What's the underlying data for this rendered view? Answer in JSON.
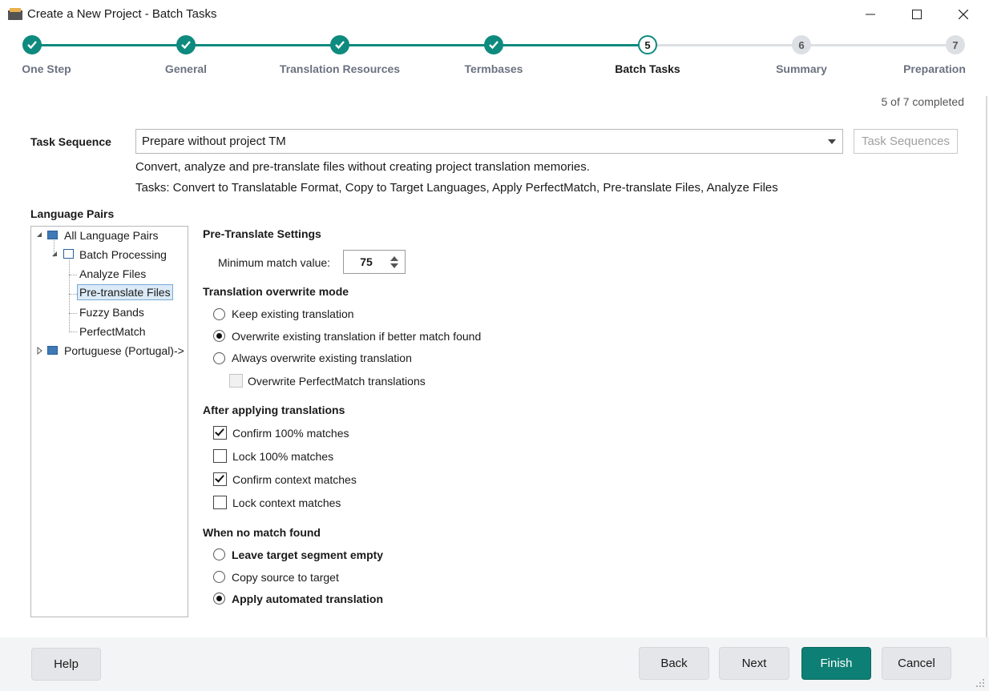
{
  "window": {
    "title": "Create a New Project - Batch Tasks"
  },
  "stepper": {
    "steps": [
      {
        "label": "One Step",
        "number": "1",
        "state": "done"
      },
      {
        "label": "General",
        "number": "2",
        "state": "done"
      },
      {
        "label": "Translation Resources",
        "number": "3",
        "state": "done"
      },
      {
        "label": "Termbases",
        "number": "4",
        "state": "done"
      },
      {
        "label": "Batch Tasks",
        "number": "5",
        "state": "current"
      },
      {
        "label": "Summary",
        "number": "6",
        "state": "todo"
      },
      {
        "label": "Preparation",
        "number": "7",
        "state": "todo"
      }
    ],
    "progress_text": "5 of 7 completed",
    "accent_color": "#0e8a7e"
  },
  "task_sequence": {
    "label": "Task Sequence",
    "selected": "Prepare without project TM",
    "button_label": "Task Sequences",
    "description": "Convert, analyze and pre-translate files without creating project translation memories.",
    "tasks": "Tasks: Convert to Translatable Format, Copy to Target Languages, Apply PerfectMatch, Pre-translate Files, Analyze Files"
  },
  "language_pairs": {
    "label": "Language Pairs",
    "tree": {
      "root": "All Language Pairs",
      "batch": "Batch Processing",
      "children": [
        "Analyze Files",
        "Pre-translate Files",
        "Fuzzy Bands",
        "PerfectMatch"
      ],
      "selected": "Pre-translate Files",
      "other": "Portuguese (Portugal)->"
    }
  },
  "settings": {
    "pretranslate_title": "Pre-Translate Settings",
    "min_match_label": "Minimum match value:",
    "min_match_value": "75",
    "overwrite_title": "Translation overwrite mode",
    "overwrite_options": [
      {
        "label": "Keep existing translation",
        "selected": false
      },
      {
        "label": "Overwrite existing translation if better match found",
        "selected": true
      },
      {
        "label": "Always overwrite existing translation",
        "selected": false
      }
    ],
    "overwrite_perfectmatch": {
      "label": "Overwrite PerfectMatch translations",
      "checked": false,
      "enabled": false
    },
    "after_title": "After applying translations",
    "after_options": [
      {
        "label": "Confirm 100% matches",
        "checked": true
      },
      {
        "label": "Lock 100% matches",
        "checked": false
      },
      {
        "label": "Confirm context matches",
        "checked": true
      },
      {
        "label": "Lock context matches",
        "checked": false
      }
    ],
    "nomatch_title": "When no match found",
    "nomatch_options": [
      {
        "label": "Leave target segment empty",
        "selected": false
      },
      {
        "label": "Copy source to target",
        "selected": false
      },
      {
        "label": "Apply automated translation",
        "selected": true
      }
    ]
  },
  "footer": {
    "help": "Help",
    "back": "Back",
    "next": "Next",
    "finish": "Finish",
    "cancel": "Cancel"
  }
}
